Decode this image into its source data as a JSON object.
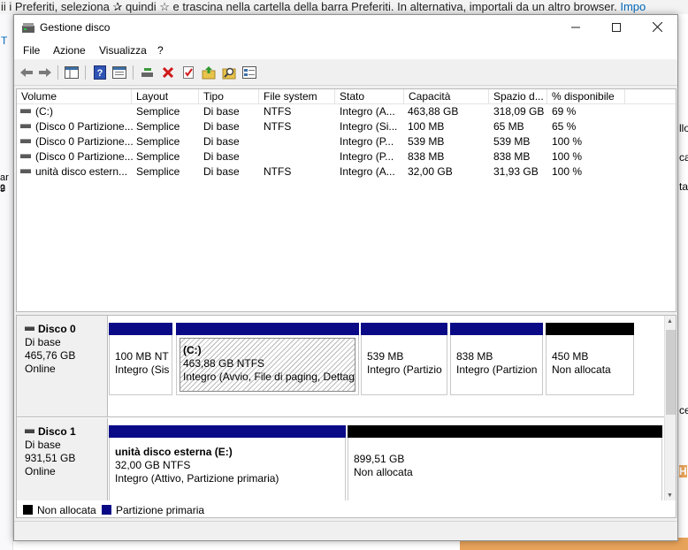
{
  "background": {
    "banner_text": "ii i Preferiti, seleziona ✰ quindi ☆ e trascina nella cartella della barra Preferiti. In alternativa, importali da un altro browser.",
    "banner_link": "Impo",
    "left_fragments": [
      "T",
      "ar 2",
      "9"
    ],
    "right_fragments": [
      "llo",
      "ca",
      "ta",
      "ce",
      "H"
    ]
  },
  "window": {
    "title": "Gestione disco",
    "icon": "disk-management-icon"
  },
  "menu": [
    "File",
    "Azione",
    "Visualizza",
    "?"
  ],
  "toolbar": [
    {
      "name": "back-icon"
    },
    {
      "name": "forward-icon"
    },
    {
      "name": "console-tree-icon"
    },
    {
      "name": "help-icon"
    },
    {
      "name": "properties-icon"
    },
    {
      "name": "connect-disk-icon"
    },
    {
      "name": "delete-icon"
    },
    {
      "name": "check-icon"
    },
    {
      "name": "folder-up-icon"
    },
    {
      "name": "search-icon"
    },
    {
      "name": "view-icon"
    }
  ],
  "volume_table": {
    "columns": [
      "Volume",
      "Layout",
      "Tipo",
      "File system",
      "Stato",
      "Capacità",
      "Spazio d...",
      "% disponibile"
    ],
    "rows": [
      [
        "(C:)",
        "Semplice",
        "Di base",
        "NTFS",
        "Integro (A...",
        "463,88 GB",
        "318,09 GB",
        "69 %"
      ],
      [
        "(Disco 0 Partizione...",
        "Semplice",
        "Di base",
        "NTFS",
        "Integro (Si...",
        "100 MB",
        "65 MB",
        "65 %"
      ],
      [
        "(Disco 0 Partizione...",
        "Semplice",
        "Di base",
        "",
        "Integro (P...",
        "539 MB",
        "539 MB",
        "100 %"
      ],
      [
        "(Disco 0 Partizione...",
        "Semplice",
        "Di base",
        "",
        "Integro (P...",
        "838 MB",
        "838 MB",
        "100 %"
      ],
      [
        "unità disco estern...",
        "Semplice",
        "Di base",
        "NTFS",
        "Integro (A...",
        "32,00 GB",
        "31,93 GB",
        "100 %"
      ]
    ]
  },
  "disks": [
    {
      "name": "Disco 0",
      "type": "Di base",
      "size": "465,76 GB",
      "status": "Online",
      "partitions": [
        {
          "title": "",
          "line1": "100 MB NT",
          "line2": "Integro (Sis",
          "kind": "primary"
        },
        {
          "title": "(C:)",
          "line1": "463,88 GB NTFS",
          "line2": "Integro (Avvio, File di paging, Dettag",
          "kind": "primary",
          "selected": true
        },
        {
          "title": "",
          "line1": "539 MB",
          "line2": "Integro (Partizio",
          "kind": "primary"
        },
        {
          "title": "",
          "line1": "838 MB",
          "line2": "Integro (Partizion",
          "kind": "primary"
        },
        {
          "title": "",
          "line1": "450 MB",
          "line2": "Non allocata",
          "kind": "unallocated"
        }
      ]
    },
    {
      "name": "Disco 1",
      "type": "Di base",
      "size": "931,51 GB",
      "status": "Online",
      "partitions": [
        {
          "title": "unità disco esterna  (E:)",
          "line1": "32,00 GB NTFS",
          "line2": "Integro (Attivo, Partizione primaria)",
          "kind": "primary"
        },
        {
          "title": "",
          "line1": "899,51 GB",
          "line2": "Non allocata",
          "kind": "unallocated"
        }
      ]
    }
  ],
  "legend": [
    {
      "label": "Non allocata",
      "color": "#000000"
    },
    {
      "label": "Partizione primaria",
      "color": "#0a0a87"
    }
  ],
  "colors": {
    "primary": "#0a0a87",
    "unallocated": "#000000"
  }
}
